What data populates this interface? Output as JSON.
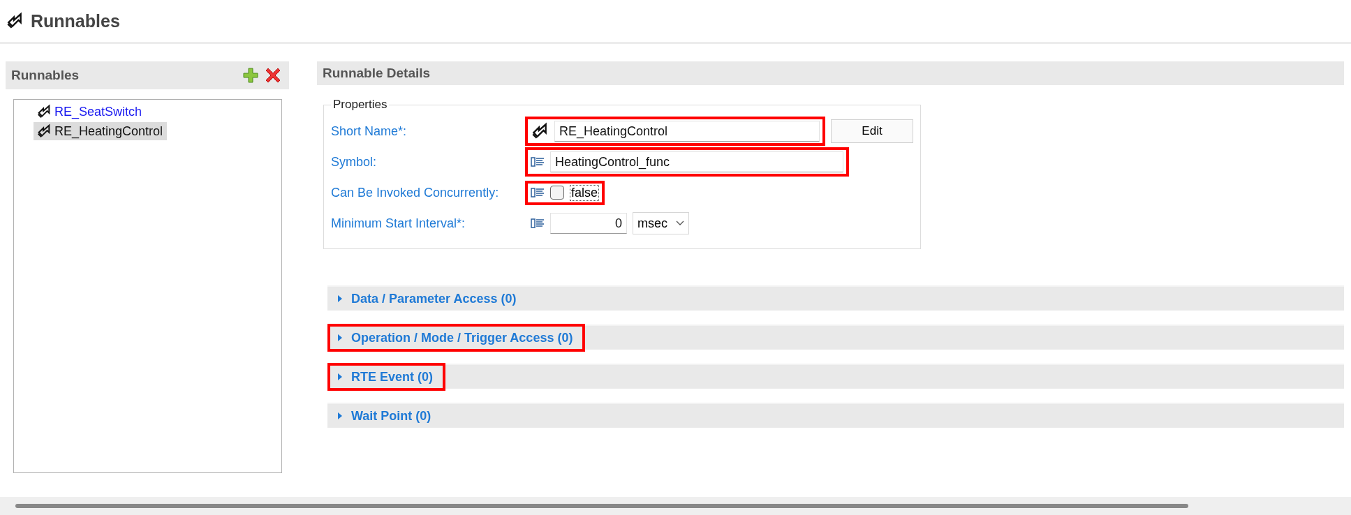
{
  "page": {
    "title": "Runnables"
  },
  "list_panel": {
    "title": "Runnables",
    "items": [
      {
        "label": "RE_SeatSwitch",
        "selected": false
      },
      {
        "label": "RE_HeatingControl",
        "selected": true
      }
    ]
  },
  "details": {
    "title": "Runnable Details",
    "group_title": "Properties",
    "fields": [
      {
        "kind": "name",
        "label": "Short Name*:",
        "value": "RE_HeatingControl",
        "button": "Edit",
        "highlighted": true
      },
      {
        "kind": "text",
        "label": "Symbol:",
        "value": "HeatingControl_func",
        "highlighted": true
      },
      {
        "kind": "checkbox",
        "label": "Can Be Invoked Concurrently:",
        "checked": false,
        "value": "false",
        "highlighted": true
      },
      {
        "kind": "interval",
        "label": "Minimum Start Interval*:",
        "value": "0",
        "unit": "msec",
        "highlighted": false
      }
    ],
    "sections": [
      {
        "title": "Data / Parameter Access (0)",
        "expanded": false,
        "highlighted": false
      },
      {
        "title": "Operation / Mode / Trigger Access (0)",
        "expanded": false,
        "highlighted": true
      },
      {
        "title": "RTE Event (0)",
        "expanded": false,
        "highlighted": true
      },
      {
        "title": "Wait Point (0)",
        "expanded": false,
        "highlighted": false
      }
    ]
  }
}
